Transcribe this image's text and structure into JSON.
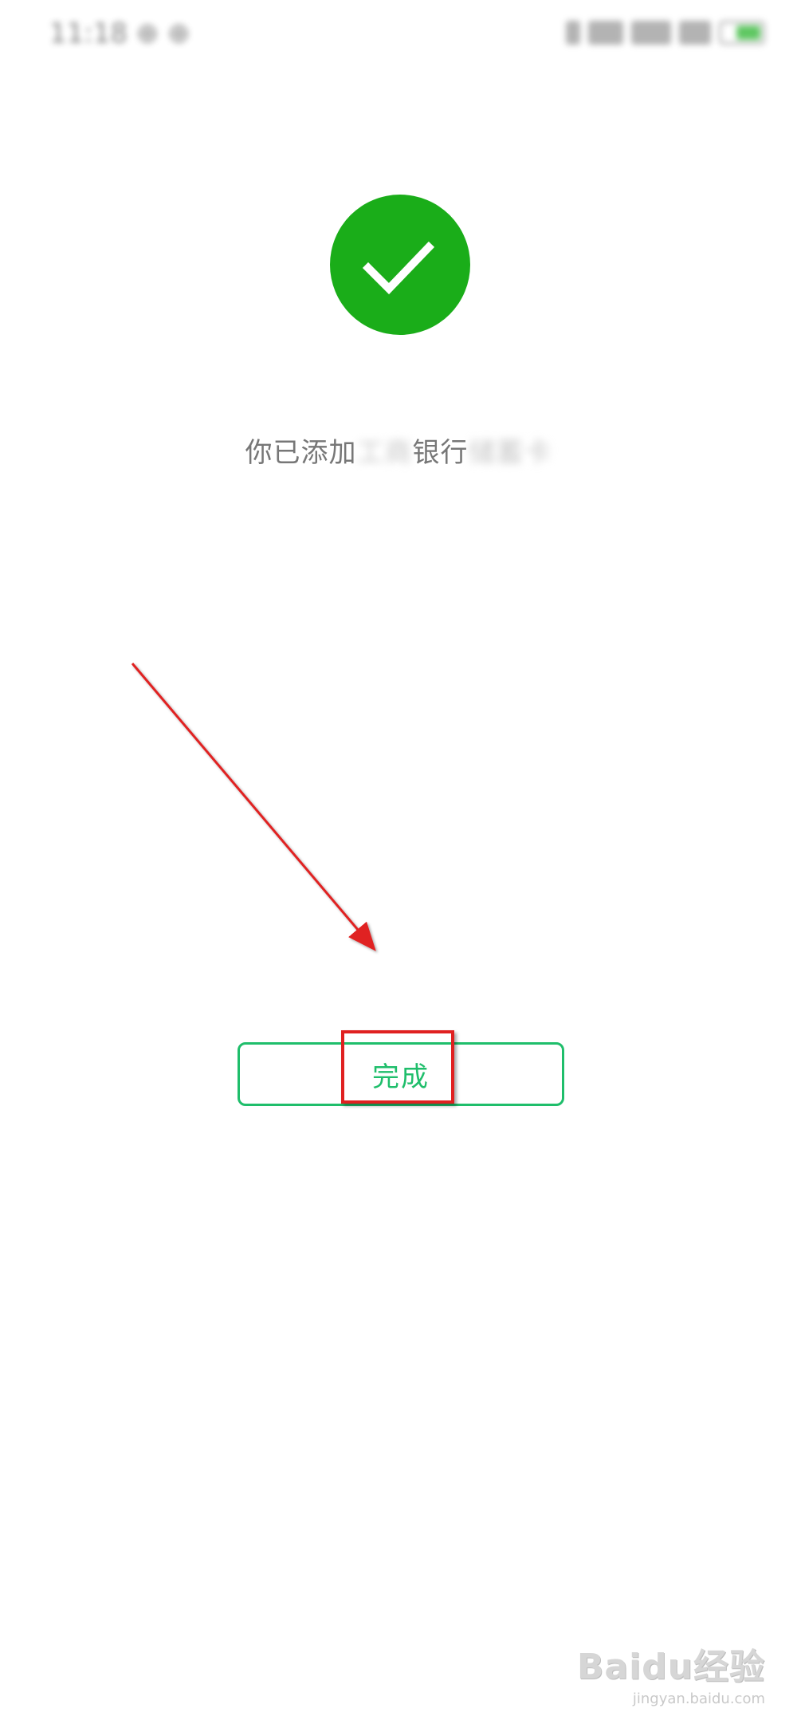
{
  "status_bar": {
    "time": "11:18 ⊕ ⊕"
  },
  "success": {
    "icon": "checkmark-icon",
    "color": "#1aad19"
  },
  "message": {
    "prefix": "你已添加",
    "masked_1": "工商",
    "middle": "银行",
    "masked_2": "储蓄卡"
  },
  "done_button": {
    "label": "完成",
    "color": "#1fbe6b"
  },
  "annotation": {
    "color": "#e02020"
  },
  "watermark": {
    "logo": "Baidu经验",
    "url": "jingyan.baidu.com"
  }
}
